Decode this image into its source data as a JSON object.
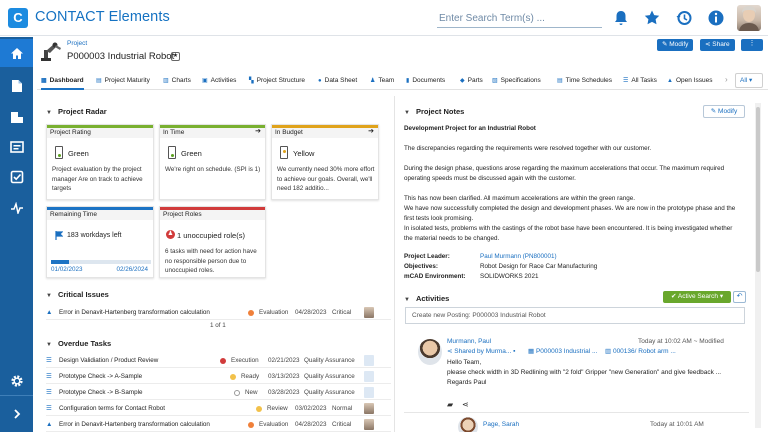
{
  "app": {
    "logo_letter": "C",
    "title": "CONTACT Elements"
  },
  "search": {
    "placeholder": "Enter Search Term(s) ..."
  },
  "header": {
    "breadcrumb": "Project",
    "title": "P000003 Industrial Robot",
    "star": "★",
    "modify_label": "Modify",
    "share_label": "Share",
    "more_label": "⋮"
  },
  "tabs": [
    {
      "label": "Dashboard"
    },
    {
      "label": "Project Maturity"
    },
    {
      "label": "Charts"
    },
    {
      "label": "Activities"
    },
    {
      "label": "Project Structure"
    },
    {
      "label": "Data Sheet"
    },
    {
      "label": "Team"
    },
    {
      "label": "Documents"
    },
    {
      "label": "Parts"
    },
    {
      "label": "Specifications"
    },
    {
      "label": "Time Schedules"
    },
    {
      "label": "All Tasks"
    },
    {
      "label": "Open Issues"
    }
  ],
  "tabs_more": "All",
  "radar": {
    "title": "Project Radar",
    "cards": [
      {
        "title": "Project Rating",
        "status": "Green",
        "text": "Project evaluation by the project manager Are on track to achieve targets"
      },
      {
        "title": "In Time",
        "arrow": "➔",
        "status": "Green",
        "text": "We're right on schedule. (SPI is 1)"
      },
      {
        "title": "In Budget",
        "arrow": "➔",
        "status": "Yellow",
        "text": "We currently need 30% more effort to achieve our goals. Overall, we'll need 182 additio..."
      }
    ],
    "remaining": {
      "title": "Remaining Time",
      "value": "183 workdays left",
      "progress": 0.18,
      "start": "01/02/2023",
      "end": "02/26/2024"
    },
    "roles": {
      "title": "Project Roles",
      "value": "1 unoccupied role(s)",
      "text": "6 tasks with need for action have no responsible person due to unoccupied roles."
    }
  },
  "critical": {
    "title": "Critical Issues",
    "rows": [
      {
        "name": "Error in Denavit-Hartenberg transformation calculation",
        "status": "Evaluation",
        "date": "04/28/2023",
        "priority": "Critical"
      }
    ],
    "pager": "1 of 1"
  },
  "overdue": {
    "title": "Overdue Tasks",
    "rows": [
      {
        "name": "Design Validiation / Product Review",
        "status": "Execution",
        "date": "02/21/2023",
        "group": "Quality Assurance"
      },
      {
        "name": "Prototype Check -> A-Sample",
        "status": "Ready",
        "date": "03/13/2023",
        "group": "Quality Assurance"
      },
      {
        "name": "Prototype Check -> B-Sample",
        "status": "New",
        "date": "03/28/2023",
        "group": "Quality Assurance"
      },
      {
        "name": "Configuration terms for Contact Robot",
        "status": "Review",
        "date": "03/02/2023",
        "group": "Normal"
      },
      {
        "name": "Error in Denavit-Hartenberg transformation calculation",
        "status": "Evaluation",
        "date": "04/28/2023",
        "group": "Critical"
      }
    ]
  },
  "notes": {
    "title": "Project Notes",
    "modify_label": "Modify",
    "heading": "Development Project for an Industrial Robot",
    "p1": "The discrepancies regarding the requirements were resolved together with our customer.",
    "p2a": "During the design phase, questions arose regarding the maximum accelerations that occur. The maximum required",
    "p2b": "operating speeds must be discussed again with the customer.",
    "p3a": "This has now been clarified. All maximum accelerations are within the green range.",
    "p3b": "We have now successfully completed the design and development phases. We are now in the prototype phase and the",
    "p3c": "first tests look promising.",
    "p3d": "In isolated tests, problems with the castings of the robot base have been encountered. It is being investigated whether",
    "p3e": "the material needs to be changed.",
    "leader_key": "Project Leader:",
    "leader_val": "Paul Murmann (PN800001)",
    "obj_key": "Objectives:",
    "obj_val": "Robot Design for Race Car Manufacturing",
    "mcad_key": "mCAD Environment:",
    "mcad_val": "SOLIDWORKS 2021"
  },
  "activities": {
    "title": "Activities",
    "active_search": "Active Search",
    "posting_placeholder": "Create new Posting: P000003 Industrial Robot",
    "post": {
      "author": "Murmann, Paul",
      "time": "Today at 10:02 AM",
      "modified": "Modified",
      "shared": "Shared by Murma...",
      "ref1": "P000003 Industrial ...",
      "ref2": "000136/ Robot arm ...",
      "line1": "Hello Team,",
      "line2": "please check width in 3D Redlining with \"2 fold\" Gripper \"new Generation\" and give feedback ...",
      "line3": "Regards Paul"
    },
    "post2": {
      "author": "Page, Sarah",
      "time": "Today at 10:01 AM"
    }
  },
  "colors": {
    "primary": "#1a6fc0",
    "sidebar": "#1a5f9d",
    "green": "#79b030",
    "yellow": "#e0a31b",
    "red": "#d13b3b"
  }
}
